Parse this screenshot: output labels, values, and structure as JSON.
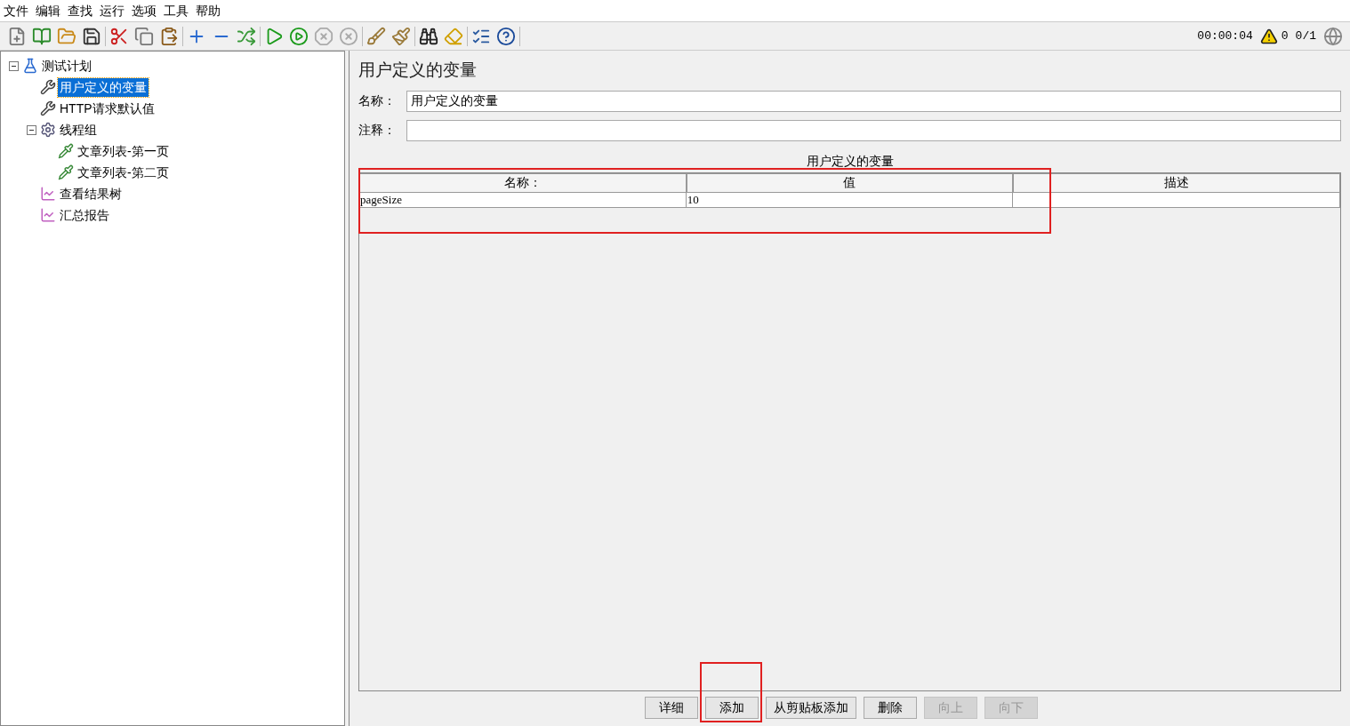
{
  "menu": [
    "文件",
    "编辑",
    "查找",
    "运行",
    "选项",
    "工具",
    "帮助"
  ],
  "status": {
    "timer": "00:00:04",
    "warnings": "0",
    "threads": "0/1"
  },
  "tree": [
    {
      "label": "测试计划",
      "kind": "plan",
      "selected": false,
      "expanded": true,
      "children": [
        {
          "label": "用户定义的变量",
          "kind": "config",
          "selected": true
        },
        {
          "label": "HTTP请求默认值",
          "kind": "config",
          "selected": false
        },
        {
          "label": "线程组",
          "kind": "threadgroup",
          "selected": false,
          "expanded": true,
          "children": [
            {
              "label": "文章列表-第一页",
              "kind": "sampler",
              "selected": false
            },
            {
              "label": "文章列表-第二页",
              "kind": "sampler",
              "selected": false
            }
          ]
        },
        {
          "label": "查看结果树",
          "kind": "listener",
          "selected": false
        },
        {
          "label": "汇总报告",
          "kind": "listener",
          "selected": false
        }
      ]
    }
  ],
  "panel": {
    "title": "用户定义的变量",
    "name_label": "名称：",
    "name_value": "用户定义的变量",
    "comment_label": "注释："
  },
  "table": {
    "title": "用户定义的变量",
    "columns": [
      "名称：",
      "值",
      "描述"
    ],
    "rows": [
      [
        "pageSize",
        "10"
      ]
    ]
  },
  "buttons": [
    {
      "label": "详细",
      "disabled": false
    },
    {
      "label": "添加",
      "disabled": false
    },
    {
      "label": "从剪贴板添加",
      "disabled": false
    },
    {
      "label": "删除",
      "disabled": false
    },
    {
      "label": "向上",
      "disabled": true
    },
    {
      "label": "向下",
      "disabled": true
    }
  ]
}
